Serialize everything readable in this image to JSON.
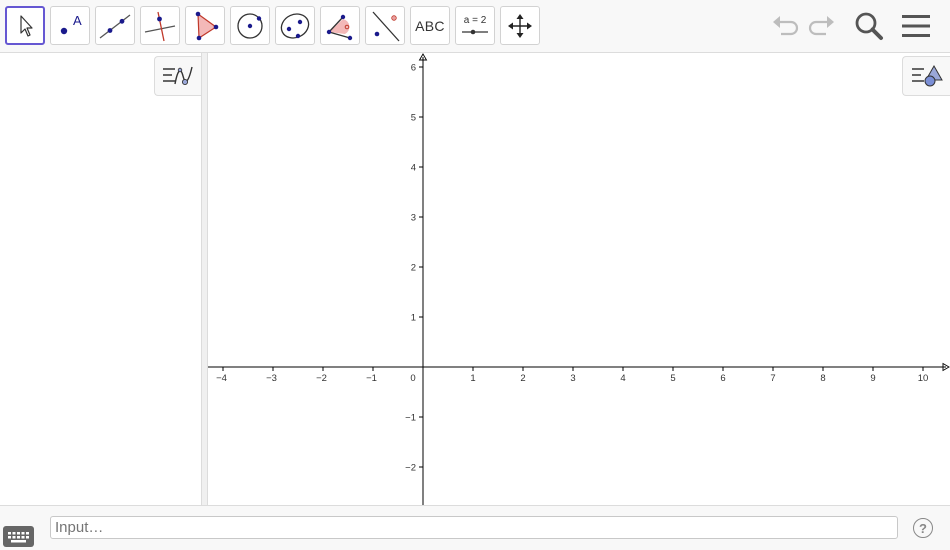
{
  "toolbar": {
    "tools": [
      {
        "name": "Move",
        "icon": "arrow-cursor-icon"
      },
      {
        "name": "Point",
        "icon": "point-icon"
      },
      {
        "name": "Line",
        "icon": "line-icon"
      },
      {
        "name": "Perpendicular Line",
        "icon": "perpendicular-line-icon"
      },
      {
        "name": "Polygon",
        "icon": "polygon-icon"
      },
      {
        "name": "Circle with Center through Point",
        "icon": "circle-icon"
      },
      {
        "name": "Ellipse",
        "icon": "ellipse-icon"
      },
      {
        "name": "Angle",
        "icon": "angle-icon"
      },
      {
        "name": "Reflect about Line",
        "icon": "reflect-icon"
      },
      {
        "name": "Text",
        "icon": "text-icon",
        "label": "ABC"
      },
      {
        "name": "Slider",
        "icon": "slider-icon",
        "label": "a = 2"
      },
      {
        "name": "Move Graphics View",
        "icon": "move-view-icon"
      }
    ],
    "selected_tool": "Move",
    "right": [
      "undo-icon",
      "redo-icon",
      "search-icon",
      "menu-icon"
    ]
  },
  "graphics": {
    "x_ticks": [
      "−4",
      "−3",
      "−2",
      "−1",
      "1",
      "2",
      "3",
      "4",
      "5",
      "6",
      "7",
      "8",
      "9",
      "10"
    ],
    "y_ticks": [
      "6",
      "5",
      "4",
      "3",
      "2",
      "1",
      "−1",
      "−2"
    ],
    "origin_label": "0",
    "accent_color": "#6557d2",
    "axis_color": "#000000"
  },
  "input_bar": {
    "placeholder": "Input…",
    "help_label": "?"
  }
}
